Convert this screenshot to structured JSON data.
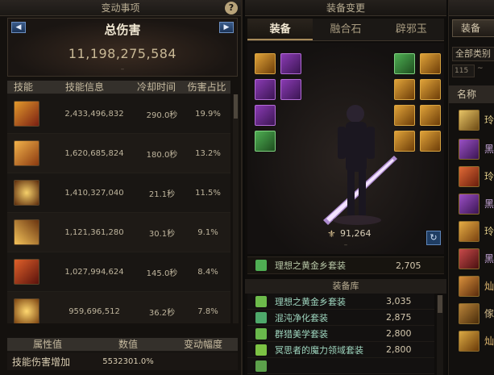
{
  "left_panel": {
    "title": "变动事项",
    "help_label": "?",
    "prev_label": "◀",
    "next_label": "▶",
    "total_label": "总伤害",
    "total_value": "11,198,275,584",
    "total_sub": "–",
    "skill_headers": [
      "技能",
      "技能信息",
      "冷却时间",
      "伤害占比"
    ],
    "skills": [
      {
        "damage": "2,433,496,832",
        "cooldown": "290.0秒",
        "percent": "19.9%",
        "icon_color": "#c0571b"
      },
      {
        "damage": "1,620,685,824",
        "cooldown": "180.0秒",
        "percent": "13.2%",
        "icon_color": "#e08a2a"
      },
      {
        "damage": "1,410,327,040",
        "cooldown": "21.1秒",
        "percent": "11.5%",
        "icon_color": "#d3962f"
      },
      {
        "damage": "1,121,361,280",
        "cooldown": "30.1秒",
        "percent": "9.1%",
        "icon_color": "#cf8d2a"
      },
      {
        "damage": "1,027,994,624",
        "cooldown": "145.0秒",
        "percent": "8.4%",
        "icon_color": "#b0361f"
      },
      {
        "damage": "959,696,512",
        "cooldown": "36.2秒",
        "percent": "7.8%",
        "icon_color": "#e0a331"
      }
    ],
    "attr_headers": [
      "属性值",
      "数值",
      "变动幅度"
    ],
    "attr_row": {
      "name": "技能伤害增加",
      "value": "5532301.0%",
      "change": ""
    }
  },
  "middle_panel": {
    "title": "装备变更",
    "tabs": [
      "装备",
      "融合石",
      "辟邪玉"
    ],
    "active_tab": 0,
    "fame_value": "91,264",
    "fame_sub": "–",
    "refresh_label": "↻",
    "main_set": {
      "name": "理想之黄金乡套装",
      "value": "2,705"
    },
    "library_title": "装备库",
    "library": [
      {
        "name": "理想之黄金乡套装",
        "value": "3,035",
        "icon_color": "#6dbb4b"
      },
      {
        "name": "混沌净化套装",
        "value": "2,875",
        "icon_color": "#4ea86b"
      },
      {
        "name": "群猎美学套装",
        "value": "2,800",
        "icon_color": "#69b84c"
      },
      {
        "name": "冥思者的魔力领域套装",
        "value": "2,800",
        "icon_color": "#7cc244"
      },
      {
        "name": "",
        "value": "",
        "icon_color": "#5ca04b"
      }
    ]
  },
  "right_panel": {
    "title": "",
    "sort_label": "装备",
    "category": "全部类别",
    "level_value": "115",
    "level_tilde": "~",
    "name_header": "名称",
    "items": [
      {
        "text": "玲",
        "color": "#d8b04d",
        "text_color": "#e0cc8a"
      },
      {
        "text": "黑",
        "color": "#7a3aa8",
        "text_color": "#c5a6d8"
      },
      {
        "text": "玲",
        "color": "#d05a2a",
        "text_color": "#e0cc8a"
      },
      {
        "text": "黑",
        "color": "#8b3fb8",
        "text_color": "#c5a6d8"
      },
      {
        "text": "玲",
        "color": "#d89b2e",
        "text_color": "#e0cc8a"
      },
      {
        "text": "黑",
        "color": "#b03a3a",
        "text_color": "#c5a6d8"
      },
      {
        "text": "灿",
        "color": "#c57a2c",
        "text_color": "#e0b870"
      },
      {
        "text": "傢",
        "color": "#a66f28",
        "text_color": "#d8c090"
      },
      {
        "text": "灿",
        "color": "#c8962e",
        "text_color": "#e0b870"
      }
    ]
  }
}
